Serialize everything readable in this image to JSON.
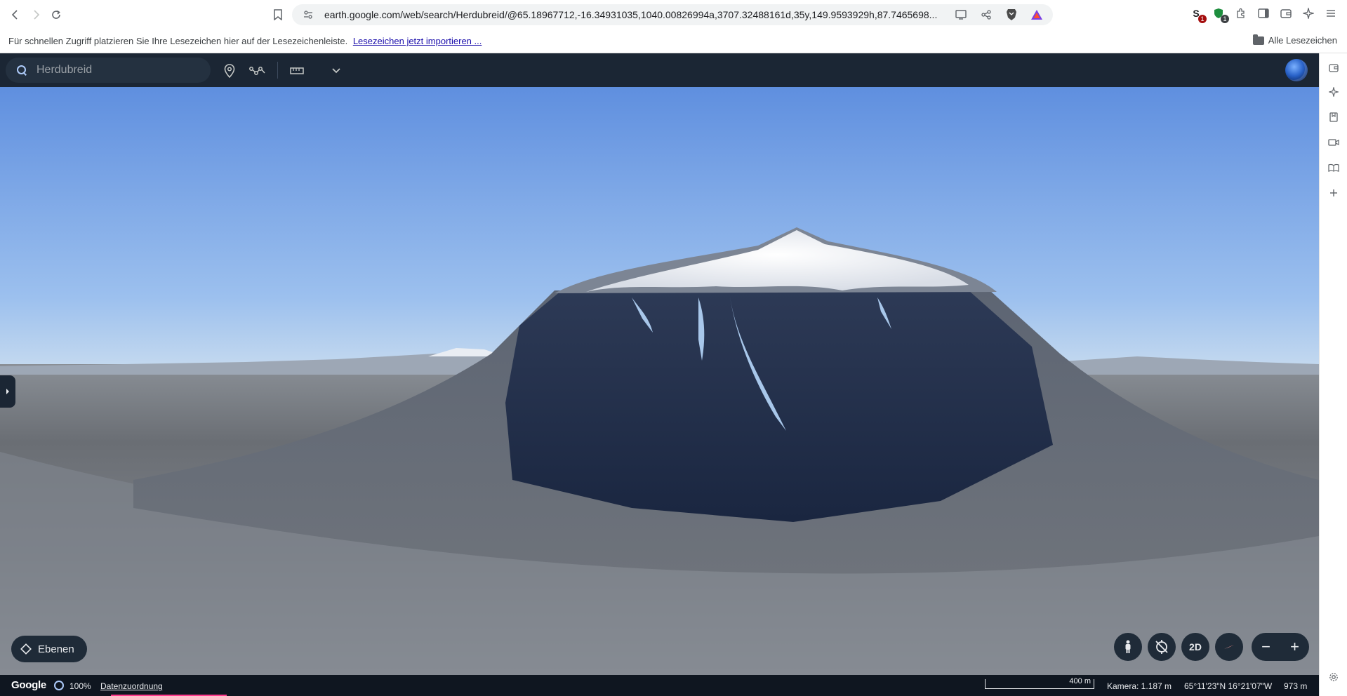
{
  "browser": {
    "url": "earth.google.com/web/search/Herdubreid/@65.18967712,-16.34931035,1040.00826994a,3707.32488161d,35y,149.9593929h,87.7465698...",
    "bookmarks_hint": "Für schnellen Zugriff platzieren Sie Ihre Lesezeichen hier auf der Lesezeichenleiste.",
    "bookmarks_import": "Lesezeichen jetzt importieren ...",
    "all_bookmarks": "Alle Lesezeichen",
    "extensions": [
      {
        "icon": "extension-s-icon",
        "badge": "1",
        "badge_color": "#a50e0e"
      },
      {
        "icon": "extension-shield-icon",
        "badge": "1",
        "badge_color": "#1e8e3e"
      }
    ]
  },
  "earth": {
    "search": {
      "value": "",
      "placeholder": "Herdubreid"
    },
    "layers_label": "Ebenen",
    "view_mode_label": "2D",
    "status": {
      "logo": "Google",
      "load_percent": "100%",
      "attribution_label": "Datenzuordnung",
      "scale": "400 m",
      "camera": "Kamera: 1.187 m",
      "coordinates": "65°11'23\"N 16°21'07\"W",
      "elevation": "973 m"
    }
  },
  "colors": {
    "header_bg": "#1b2634",
    "sky_top": "#5f8fdf",
    "sky_horizon": "#b9d2ee"
  }
}
